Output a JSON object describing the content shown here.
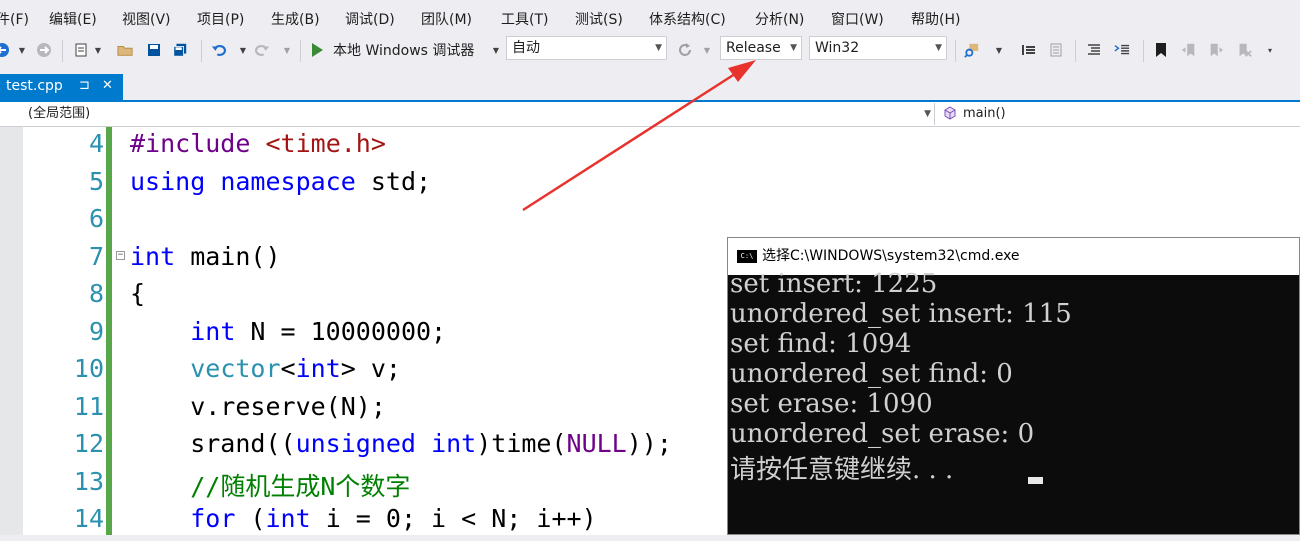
{
  "menu": [
    "件(F)",
    "编辑(E)",
    "视图(V)",
    "项目(P)",
    "生成(B)",
    "调试(D)",
    "团队(M)",
    "工具(T)",
    "测试(S)",
    "体系结构(C)",
    "分析(N)",
    "窗口(W)",
    "帮助(H)"
  ],
  "toolbar": {
    "debugger_label": "本地 Windows 调试器",
    "config_auto": "自动",
    "build_config": "Release",
    "platform": "Win32"
  },
  "tab": {
    "filename": "test.cpp",
    "pin_glyph": "⊐",
    "close_glyph": "✕"
  },
  "navbar": {
    "scope": "(全局范围)",
    "function": "main()"
  },
  "editor": {
    "lines": [
      {
        "num": "4",
        "tokens": [
          [
            "mac",
            "#include"
          ],
          [
            "",
            " "
          ],
          [
            "str",
            "<time.h>"
          ]
        ]
      },
      {
        "num": "5",
        "tokens": [
          [
            "kw",
            "using"
          ],
          [
            "",
            " "
          ],
          [
            "kw",
            "namespace"
          ],
          [
            "",
            " std;"
          ]
        ]
      },
      {
        "num": "6",
        "tokens": []
      },
      {
        "num": "7",
        "tokens": [
          [
            "kw",
            "int"
          ],
          [
            "",
            " main()"
          ]
        ]
      },
      {
        "num": "8",
        "tokens": [
          [
            "",
            "{"
          ]
        ]
      },
      {
        "num": "9",
        "tokens": [
          [
            "",
            "    "
          ],
          [
            "kw",
            "int"
          ],
          [
            "",
            " N = 10000000;"
          ]
        ]
      },
      {
        "num": "10",
        "tokens": [
          [
            "",
            "    "
          ],
          [
            "ty",
            "vector"
          ],
          [
            "",
            "<"
          ],
          [
            "kw",
            "int"
          ],
          [
            "",
            "> v;"
          ]
        ]
      },
      {
        "num": "11",
        "tokens": [
          [
            "",
            "    v.reserve(N);"
          ]
        ]
      },
      {
        "num": "12",
        "tokens": [
          [
            "",
            "    srand(("
          ],
          [
            "kw",
            "unsigned"
          ],
          [
            "",
            " "
          ],
          [
            "kw",
            "int"
          ],
          [
            "",
            ")time("
          ],
          [
            "mac",
            "NULL"
          ],
          [
            "",
            "));"
          ]
        ]
      },
      {
        "num": "13",
        "tokens": [
          [
            "",
            "    "
          ],
          [
            "cm",
            "//随机生成N个数字"
          ]
        ]
      },
      {
        "num": "14",
        "tokens": [
          [
            "",
            "    "
          ],
          [
            "kw",
            "for"
          ],
          [
            "",
            " ("
          ],
          [
            "kw",
            "int"
          ],
          [
            "",
            " i = 0; i < N; i++)"
          ]
        ]
      }
    ]
  },
  "console": {
    "title": "选择C:\\WINDOWS\\system32\\cmd.exe",
    "icon_text": "C:\\",
    "lines": [
      "set insert: 1225",
      "unordered_set insert: 115",
      "set find: 1094",
      "unordered_set find: 0",
      "set erase: 1090",
      "unordered_set erase: 0",
      "请按任意键继续. . ."
    ]
  },
  "colors": {
    "accent": "#007acc",
    "annotation_arrow": "#e8322e",
    "keyword": "#0000ff",
    "type": "#2b91af",
    "string": "#a31515",
    "comment": "#008000",
    "macro": "#6f008a"
  }
}
